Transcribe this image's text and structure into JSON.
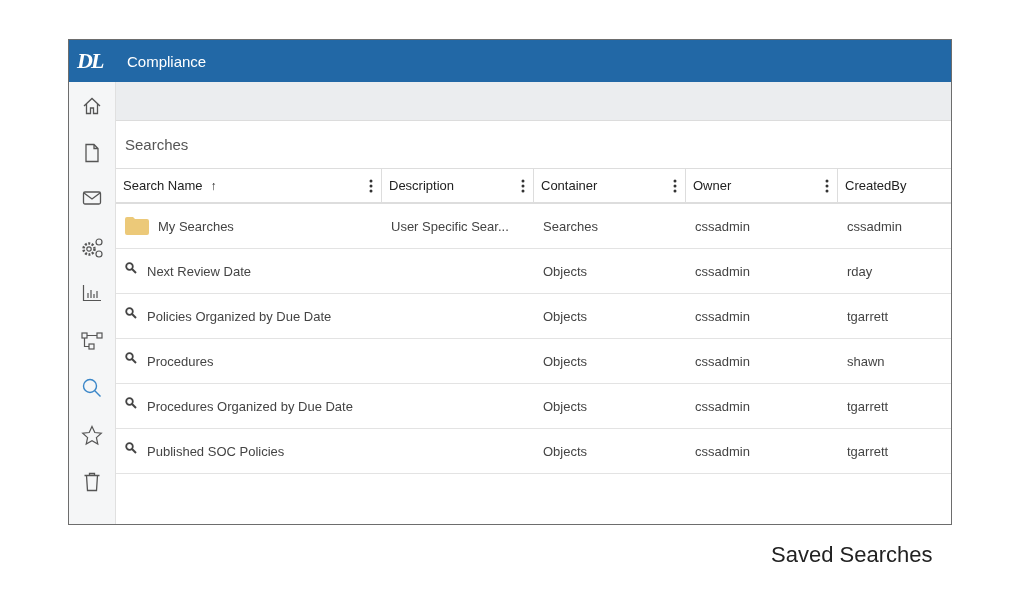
{
  "header": {
    "logo": "DL",
    "title": "Compliance"
  },
  "sidebar": {
    "items": [
      {
        "kind": "home",
        "selected": false
      },
      {
        "kind": "document",
        "selected": false
      },
      {
        "kind": "mail",
        "selected": false
      },
      {
        "kind": "gears",
        "selected": false
      },
      {
        "kind": "chart",
        "selected": false
      },
      {
        "kind": "workflow",
        "selected": false
      },
      {
        "kind": "search",
        "selected": true
      },
      {
        "kind": "star",
        "selected": false
      },
      {
        "kind": "trash",
        "selected": false
      }
    ]
  },
  "panel": {
    "title": "Searches"
  },
  "table": {
    "columns": [
      {
        "label": "Search Name",
        "sort": "↑",
        "menu": true
      },
      {
        "label": "Description",
        "menu": true
      },
      {
        "label": "Container",
        "menu": true
      },
      {
        "label": "Owner",
        "menu": true
      },
      {
        "label": "CreatedBy",
        "menu": false
      }
    ],
    "rows": [
      {
        "kind": "folder",
        "cells": [
          "My Searches",
          "User Specific Sear...",
          "Searches",
          "cssadmin",
          "cssadmin"
        ]
      },
      {
        "kind": "search",
        "cells": [
          "Next Review Date",
          "",
          "Objects",
          "cssadmin",
          "rday"
        ]
      },
      {
        "kind": "search",
        "cells": [
          "Policies Organized by Due Date",
          "",
          "Objects",
          "cssadmin",
          "tgarrett"
        ]
      },
      {
        "kind": "search",
        "cells": [
          "Procedures",
          "",
          "Objects",
          "cssadmin",
          "shawn"
        ]
      },
      {
        "kind": "search",
        "cells": [
          "Procedures Organized by Due Date",
          "",
          "Objects",
          "cssadmin",
          "tgarrett"
        ]
      },
      {
        "kind": "search",
        "cells": [
          "Published SOC Policies",
          "",
          "Objects",
          "cssadmin",
          "tgarrett"
        ]
      }
    ]
  },
  "caption": "Saved Searches"
}
